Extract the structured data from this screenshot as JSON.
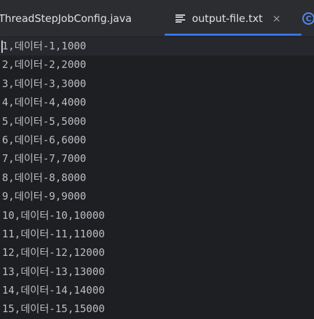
{
  "tabs": [
    {
      "label": "ThreadStepJobConfig.java",
      "active": false
    },
    {
      "label": "output-file.txt",
      "active": true,
      "icon": "text-file-icon",
      "closable": true
    },
    {
      "icon": "class-icon",
      "glyph": "C"
    }
  ],
  "close_glyph": "×",
  "accent_color": "#3574f0",
  "editor": {
    "lines": [
      "1,데이터-1,1000",
      "2,데이터-2,2000",
      "3,데이터-3,3000",
      "4,데이터-4,4000",
      "5,데이터-5,5000",
      "6,데이터-6,6000",
      "7,데이터-7,7000",
      "8,데이터-8,8000",
      "9,데이터-9,9000",
      "10,데이터-10,10000",
      "11,데이터-11,11000",
      "12,데이터-12,12000",
      "13,데이터-13,13000",
      "14,데이터-14,14000",
      "15,데이터-15,15000"
    ]
  }
}
